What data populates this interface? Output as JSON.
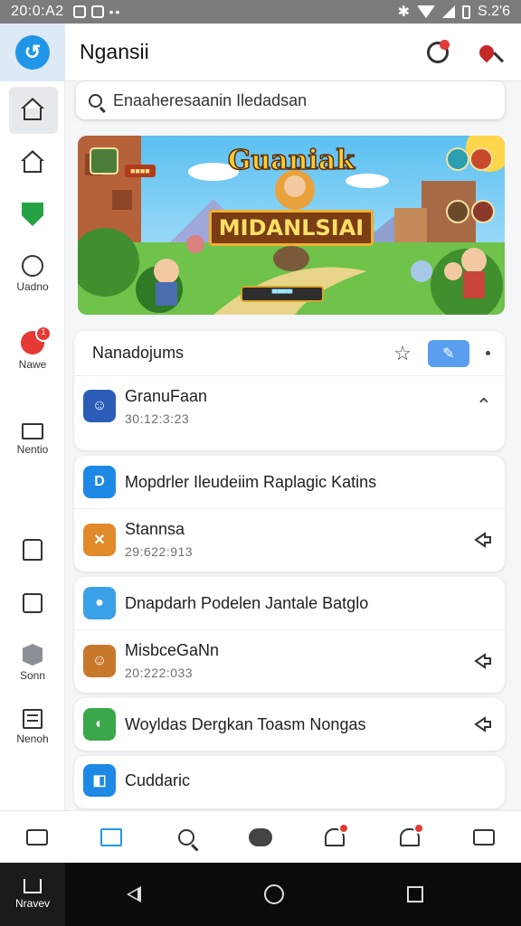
{
  "status_bar": {
    "time": "20:0:A2",
    "battery_text": "S.2'6"
  },
  "header": {
    "title": "Ngansii"
  },
  "sidebar": {
    "items": [
      {
        "label": ""
      },
      {
        "label": ""
      },
      {
        "label": ""
      },
      {
        "label": "Uadno"
      },
      {
        "label": "Nawe"
      },
      {
        "label": "Nentio"
      },
      {
        "label": ""
      },
      {
        "label": ""
      },
      {
        "label": "Sonn"
      },
      {
        "label": "Nenoh"
      }
    ]
  },
  "search": {
    "value": "Enaaheresaanin Iledadsan"
  },
  "banner": {
    "title": "Guaniak",
    "subtitle": "MIDANLSIAI",
    "mini_label": "■■■■",
    "bar_label": "▀▀▀▀"
  },
  "section": {
    "title": "Nanadojums",
    "first_row": {
      "title": "GranuFaan",
      "subtitle": "30:12:3:23"
    }
  },
  "list": [
    {
      "title": "Mopdrler Ileudeiim Raplagic Katins",
      "subtitle": ""
    },
    {
      "title": "Stannsa",
      "subtitle": "29:622:913"
    },
    {
      "title": "Dnapdarh Podelen Jantale Batglo",
      "subtitle": ""
    },
    {
      "title": "MisbceGaNn",
      "subtitle": "20:222:033"
    },
    {
      "title": "Woyldas Dergkan Toasm Nongas",
      "subtitle": ""
    },
    {
      "title": "Cuddaric",
      "subtitle": ""
    }
  ],
  "navbar": {
    "home_label": "Nravev"
  },
  "colors": {
    "accent": "#2196e8",
    "badge": "#e53935",
    "shield": "#25a244"
  }
}
